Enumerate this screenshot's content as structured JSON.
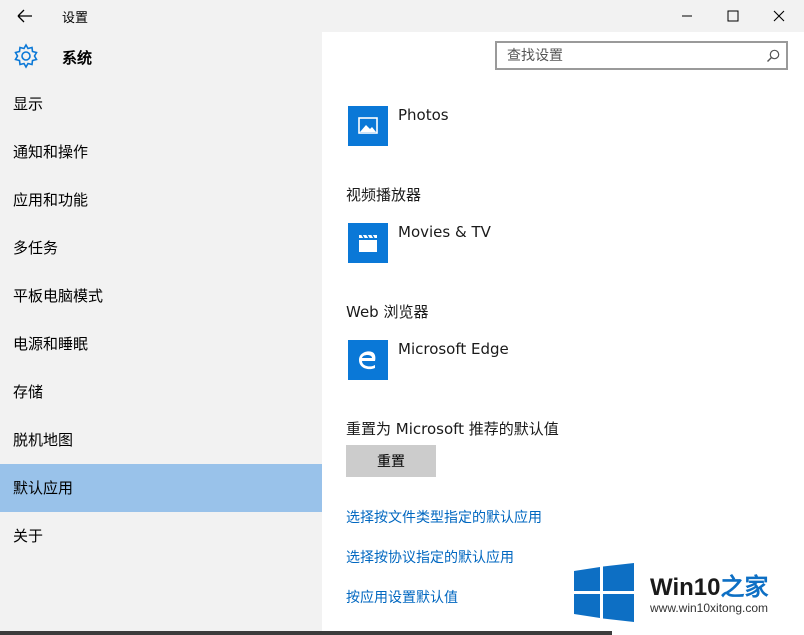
{
  "window": {
    "title": "设置",
    "back_icon": "arrow-left-icon",
    "controls": [
      "minimize-icon",
      "maximize-icon",
      "close-icon"
    ]
  },
  "sidebar": {
    "icon": "gear-icon",
    "title": "系统",
    "items": [
      {
        "label": "显示"
      },
      {
        "label": "通知和操作"
      },
      {
        "label": "应用和功能"
      },
      {
        "label": "多任务"
      },
      {
        "label": "平板电脑模式"
      },
      {
        "label": "电源和睡眠"
      },
      {
        "label": "存储"
      },
      {
        "label": "脱机地图"
      },
      {
        "label": "默认应用",
        "active": true
      },
      {
        "label": "关于"
      }
    ]
  },
  "search": {
    "placeholder": "查找设置",
    "icon": "search-icon"
  },
  "content": {
    "photo_viewer": {
      "app": "Photos",
      "icon": "photos-icon"
    },
    "video_player": {
      "heading": "视频播放器",
      "app": "Movies & TV",
      "icon": "movies-icon"
    },
    "web_browser": {
      "heading": "Web 浏览器",
      "app": "Microsoft Edge",
      "icon": "edge-icon"
    },
    "reset": {
      "heading": "重置为 Microsoft 推荐的默认值",
      "button": "重置"
    },
    "links": [
      "选择按文件类型指定的默认应用",
      "选择按协议指定的默认应用",
      "按应用设置默认值"
    ]
  },
  "watermark": {
    "brand": "Win10",
    "brand_suffix": "之家",
    "url": "www.win10xitong.com",
    "logo": "windows-logo-icon",
    "colors": {
      "accent": "#0d6fc4"
    }
  },
  "colors": {
    "sidebar_bg": "#f2f2f2",
    "active_item": "#99c2ea",
    "tile_blue": "#0a78d7",
    "link": "#0067c0",
    "button_bg": "#cccccc"
  }
}
